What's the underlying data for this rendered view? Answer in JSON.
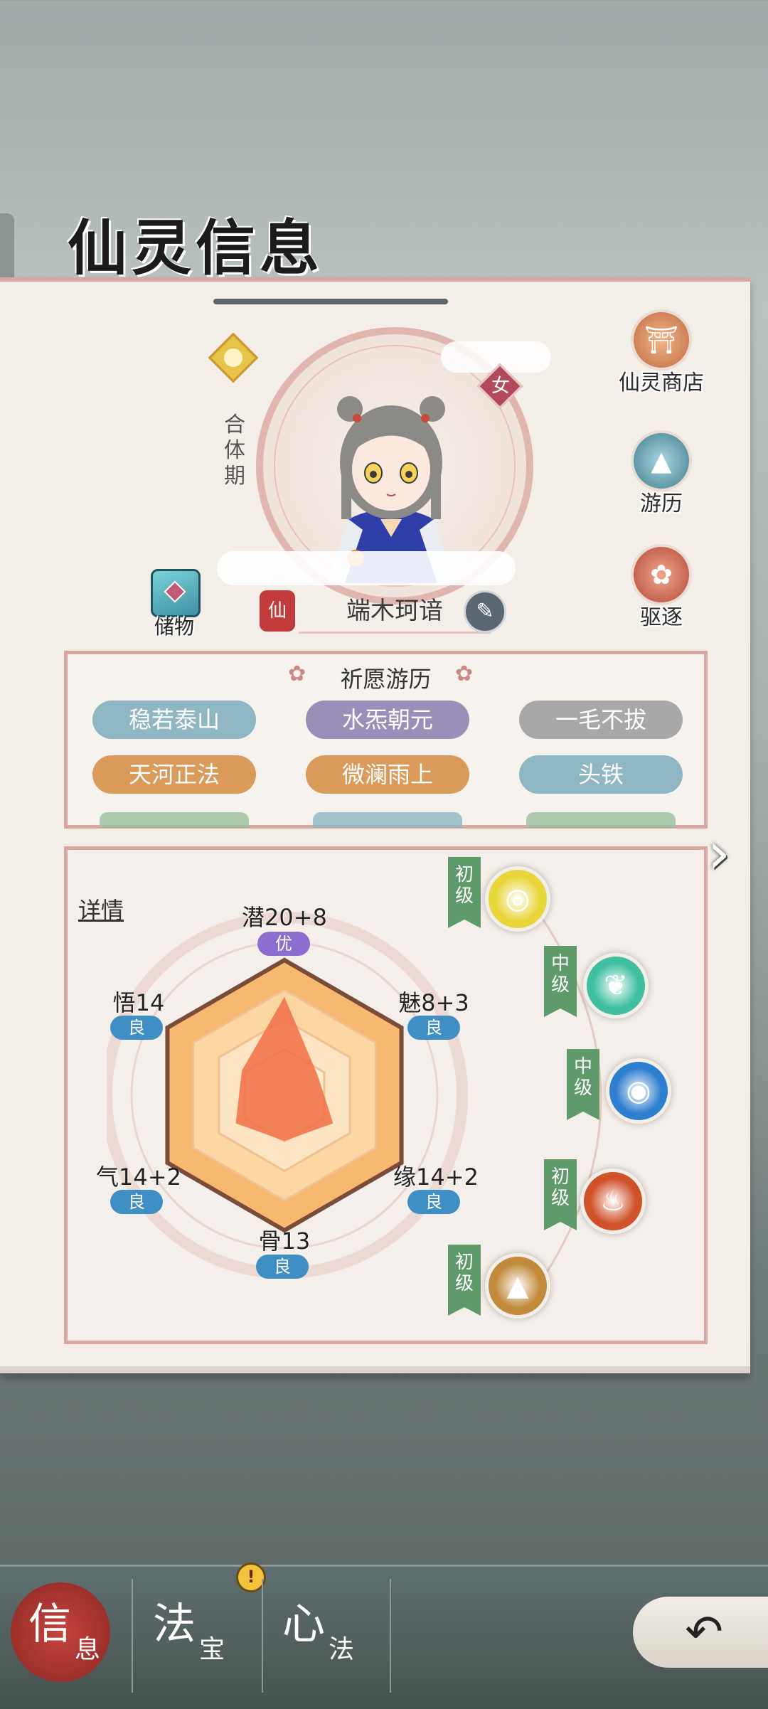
{
  "page": {
    "title": "仙灵信息"
  },
  "character": {
    "realm": "合体期",
    "gender": "女",
    "name_seal": "仙",
    "name": "端木珂谙",
    "storage_label": "储物"
  },
  "side_buttons": [
    {
      "label": "仙灵商店",
      "icon": "temple-icon"
    },
    {
      "label": "游历",
      "icon": "mountain-icon"
    },
    {
      "label": "驱逐",
      "icon": "lotus-icon"
    }
  ],
  "traits": {
    "title": "祈愿游历",
    "items": [
      {
        "label": "稳若泰山",
        "color": "#8fb7c3"
      },
      {
        "label": "水炁朝元",
        "color": "#9a8fb8"
      },
      {
        "label": "一毛不拔",
        "color": "#a8a8a8"
      },
      {
        "label": "天河正法",
        "color": "#d99a5a"
      },
      {
        "label": "微澜雨上",
        "color": "#d99a5a"
      },
      {
        "label": "头铁",
        "color": "#8fb7c3"
      }
    ]
  },
  "stats": {
    "details_label": "详情",
    "items": [
      {
        "key": "potential",
        "label": "潜20+8",
        "grade": "优",
        "grade_color": "#8b6fd0"
      },
      {
        "key": "charm",
        "label": "魅8+3",
        "grade": "良",
        "grade_color": "#3f8fc4"
      },
      {
        "key": "fate",
        "label": "缘14+2",
        "grade": "良",
        "grade_color": "#3f8fc4"
      },
      {
        "key": "bone",
        "label": "骨13",
        "grade": "良",
        "grade_color": "#3f8fc4"
      },
      {
        "key": "qi",
        "label": "气14+2",
        "grade": "良",
        "grade_color": "#3f8fc4"
      },
      {
        "key": "insight",
        "label": "悟14",
        "grade": "良",
        "grade_color": "#3f8fc4"
      }
    ],
    "radar_values": [
      28,
      11,
      16,
      13,
      16,
      14
    ],
    "radar_max": 30
  },
  "elements": [
    {
      "level": "初级",
      "element": "metal",
      "icon": "metal-swirl-icon",
      "color": "#e8d63a"
    },
    {
      "level": "中级",
      "element": "wood",
      "icon": "leaf-icon",
      "color": "#3fbf9f"
    },
    {
      "level": "中级",
      "element": "water",
      "icon": "water-swirl-icon",
      "color": "#2f7fd0"
    },
    {
      "level": "初级",
      "element": "fire",
      "icon": "flame-icon",
      "color": "#d0522b"
    },
    {
      "level": "初级",
      "element": "earth",
      "icon": "mountain-peak-icon",
      "color": "#c08a3a"
    }
  ],
  "nav": {
    "tabs": [
      {
        "big": "信",
        "small": "息"
      },
      {
        "big": "法",
        "small": "宝"
      },
      {
        "big": "心",
        "small": "法"
      }
    ],
    "alert": "!"
  }
}
